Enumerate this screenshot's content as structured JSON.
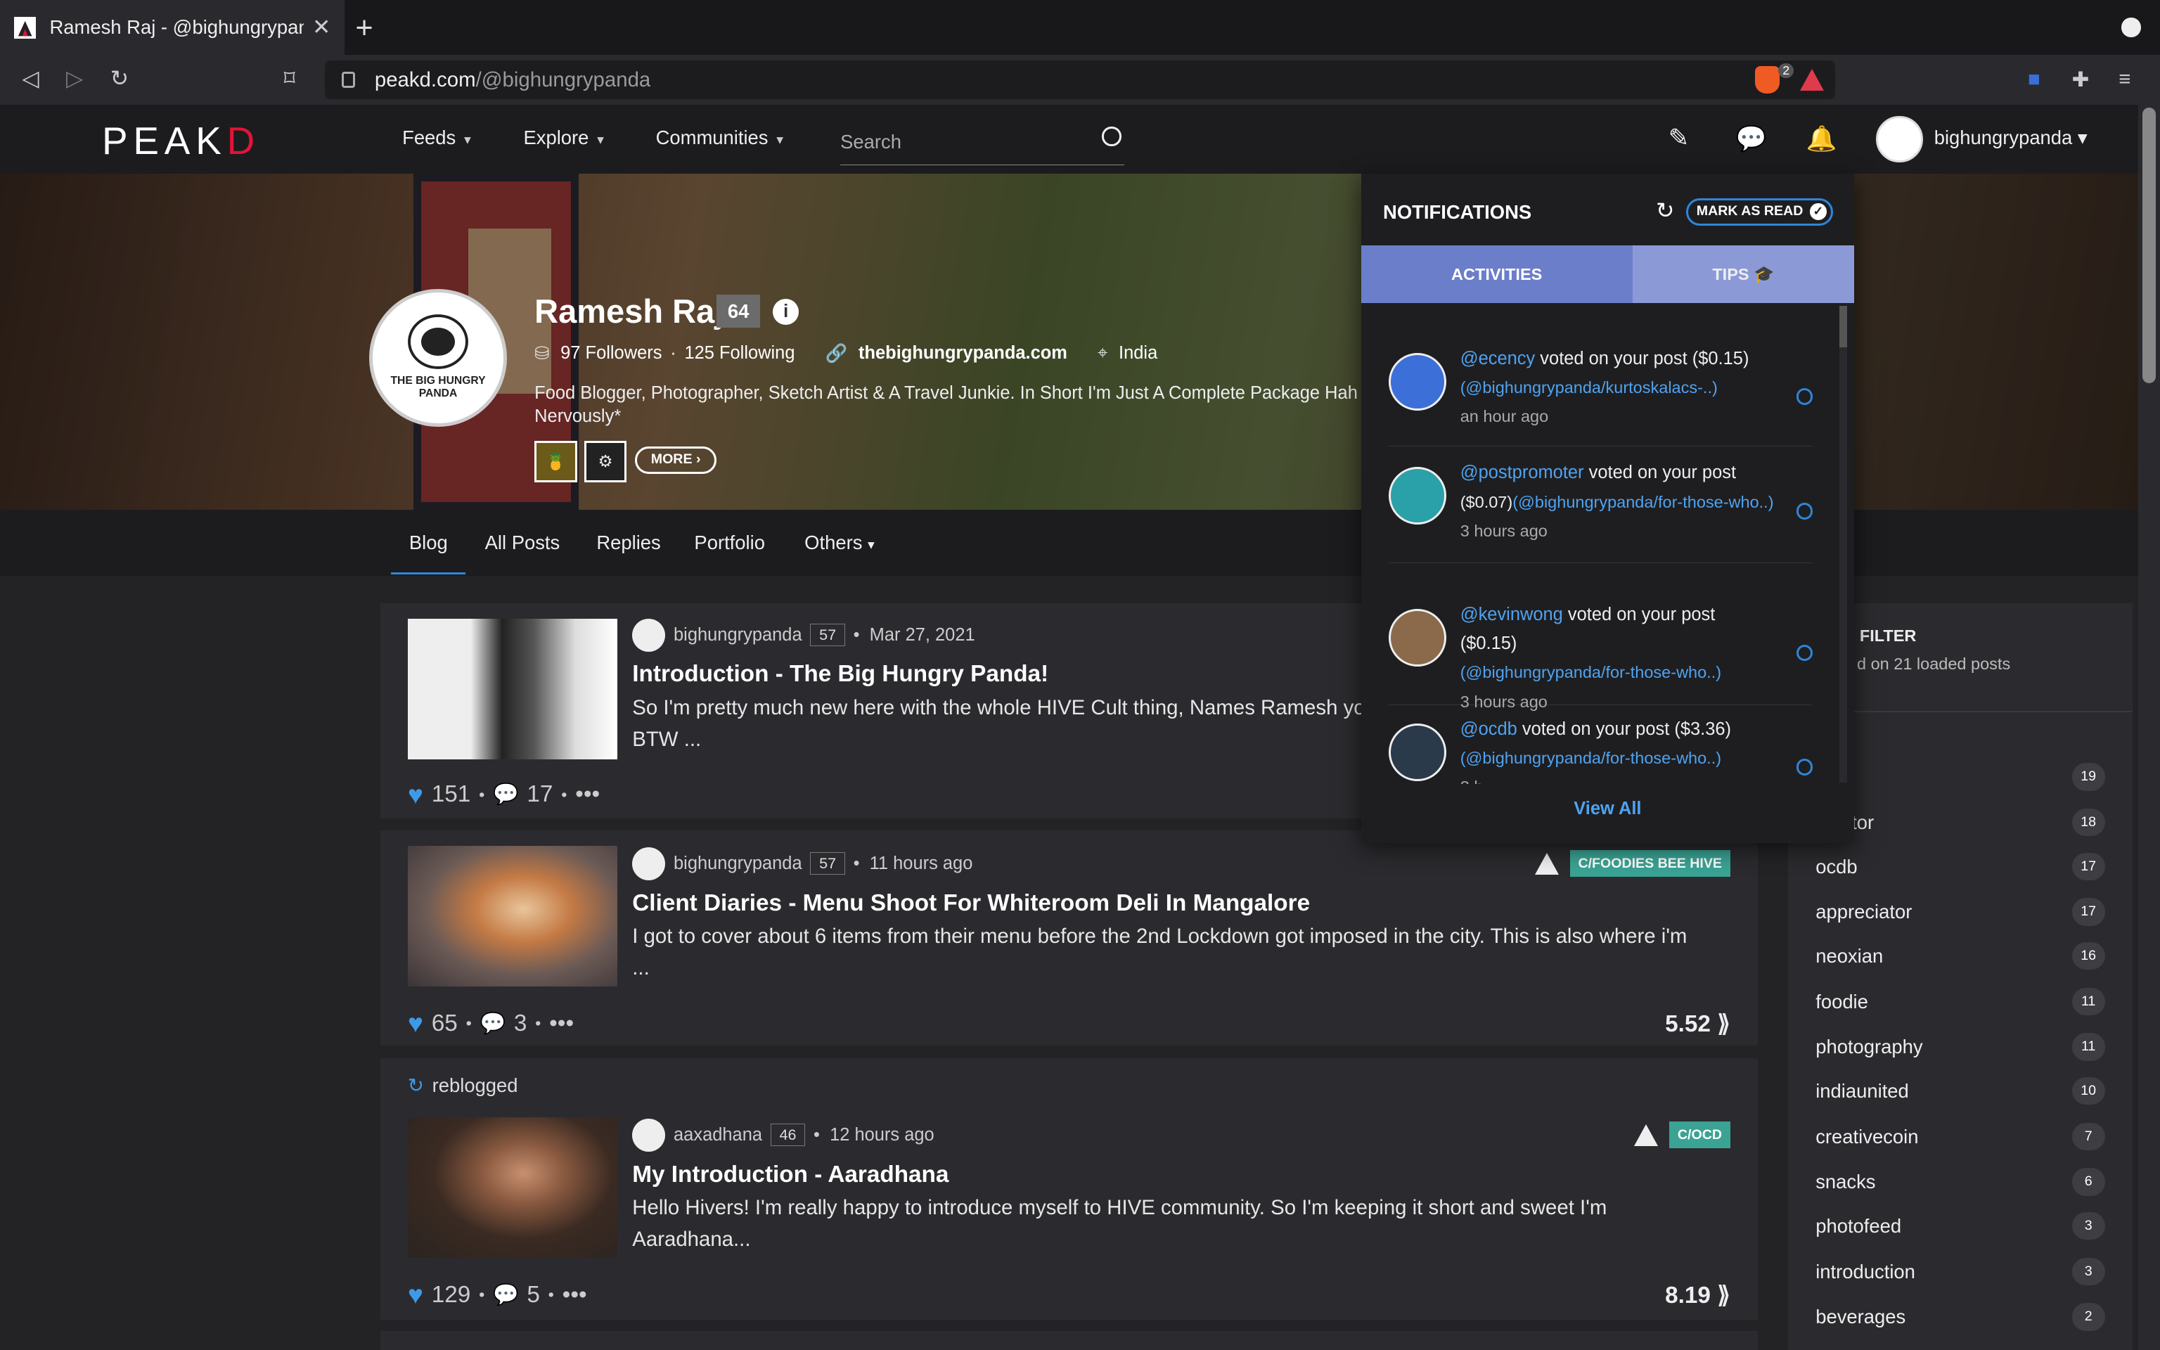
{
  "browser": {
    "tab_title": "Ramesh Raj - @bighungrypanda",
    "url_host": "peakd.com",
    "url_path": "/@bighungrypanda",
    "shields_count": "2"
  },
  "header": {
    "logo": "PEAK",
    "logo_accent": "D",
    "nav": [
      "Feeds",
      "Explore",
      "Communities"
    ],
    "search_placeholder": "Search",
    "username": "bighungrypanda"
  },
  "profile": {
    "name": "Ramesh Raj",
    "reputation": "64",
    "followers": "97 Followers",
    "following": "125 Following",
    "website": "thebighungrypanda.com",
    "location": "India",
    "bio": "Food Blogger, Photographer, Sketch Artist & A Travel Junkie. In Short I'm Just A Complete Package Hah",
    "bio2": "Nervously*",
    "avatar_text": "THE BIG HUNGRY PANDA",
    "more_label": "MORE"
  },
  "profile_tabs": [
    "Blog",
    "All Posts",
    "Replies",
    "Portfolio",
    "Others"
  ],
  "posts": [
    {
      "author": "bighungrypanda",
      "rep": "57",
      "date": "Mar 27, 2021",
      "title": "Introduction - The Big Hungry Panda!",
      "excerpt": "So I'm pretty much new here with the whole HIVE Cult thing, Names Ramesh yo",
      "excerpt2": "BTW ...",
      "votes": "151",
      "comments": "17"
    },
    {
      "author": "bighungrypanda",
      "rep": "57",
      "date": "11 hours ago",
      "title": "Client Diaries - Menu Shoot For Whiteroom Deli In Mangalore",
      "excerpt": "I got to cover about 6 items from their menu before the 2nd Lockdown got imposed in the city. This is also where i'm",
      "excerpt2": "...",
      "votes": "65",
      "comments": "3",
      "payout": "5.52",
      "community": "C/FOODIES BEE HIVE"
    },
    {
      "reblogged": "reblogged",
      "author": "aaxadhana",
      "rep": "46",
      "date": "12 hours ago",
      "title": "My Introduction - Aaradhana",
      "excerpt": "Hello Hivers! I'm really happy to introduce myself to HIVE community. So I'm keeping it short and sweet I'm",
      "excerpt2": "Aaradhana...",
      "votes": "129",
      "comments": "5",
      "payout": "8.19",
      "community": "C/OCD"
    }
  ],
  "tags": {
    "filter_title": "FILTER",
    "filter_sub": "d on 21 loaded posts",
    "items": [
      {
        "name": "",
        "count": "19"
      },
      {
        "name": "tor",
        "count": "18"
      },
      {
        "name": "ocdb",
        "count": "17"
      },
      {
        "name": "appreciator",
        "count": "17"
      },
      {
        "name": "neoxian",
        "count": "16"
      },
      {
        "name": "foodie",
        "count": "11"
      },
      {
        "name": "photography",
        "count": "11"
      },
      {
        "name": "indiaunited",
        "count": "10"
      },
      {
        "name": "creativecoin",
        "count": "7"
      },
      {
        "name": "snacks",
        "count": "6"
      },
      {
        "name": "photofeed",
        "count": "3"
      },
      {
        "name": "introduction",
        "count": "3"
      },
      {
        "name": "beverages",
        "count": "2"
      }
    ]
  },
  "notifications": {
    "title": "NOTIFICATIONS",
    "mark_read": "MARK AS READ",
    "tab_activities": "ACTIVITIES",
    "tab_tips": "TIPS",
    "view_all": "View All",
    "items": [
      {
        "user": "@ecency",
        "action": " voted on your post ($0.15)",
        "link": "(@bighungrypanda/kurtoskalacs-..)",
        "time": "an hour ago"
      },
      {
        "user": "@postpromoter",
        "action": " voted on your post",
        "link2": "($0.07)",
        "link": "(@bighungrypanda/for-those-who..)",
        "time": "3 hours ago"
      },
      {
        "user": "@kevinwong",
        "action": " voted on your post ($0.15)",
        "link": "(@bighungrypanda/for-those-who..)",
        "time": "3 hours ago"
      },
      {
        "user": "@ocdb",
        "action": " voted on your post ($3.36)",
        "link": "(@bighungrypanda/for-those-who..)",
        "time": "3 h"
      }
    ]
  }
}
